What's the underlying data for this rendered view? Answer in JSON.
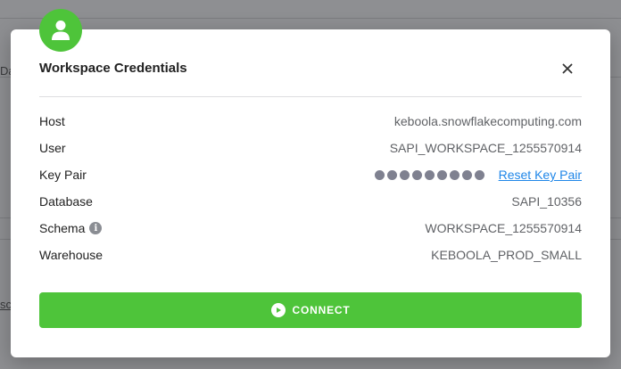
{
  "background": {
    "partial_text_top": "Da",
    "partial_link_bottom": "sc"
  },
  "modal": {
    "title": "Workspace Credentials",
    "close_icon": "close-icon",
    "avatar_icon": "user-icon",
    "accent_color": "#4ec43a",
    "rows": [
      {
        "label": "Host",
        "value": "keboola.snowflakecomputing.com"
      },
      {
        "label": "User",
        "value": "SAPI_WORKSPACE_1255570914"
      },
      {
        "label": "Key Pair",
        "value": "",
        "link": "Reset Key Pair",
        "masked_dots": 9
      },
      {
        "label": "Database",
        "value": "SAPI_10356"
      },
      {
        "label": "Schema",
        "value": "WORKSPACE_1255570914",
        "info_icon": "info-icon"
      },
      {
        "label": "Warehouse",
        "value": "KEBOOLA_PROD_SMALL"
      }
    ],
    "connect_button": {
      "label": "CONNECT",
      "icon": "play-icon"
    }
  }
}
